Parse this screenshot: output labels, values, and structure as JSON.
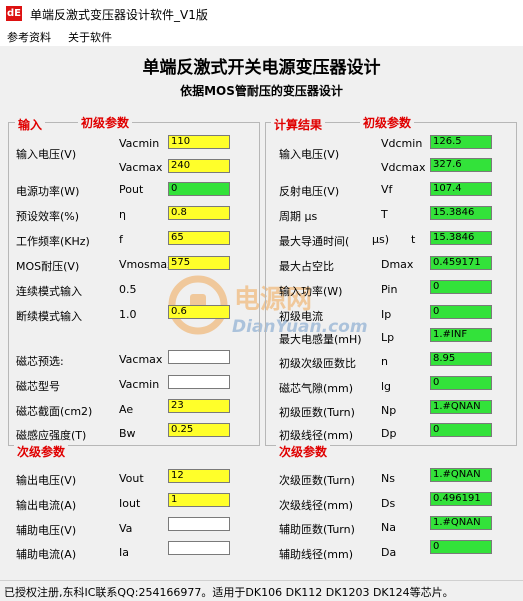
{
  "window": {
    "title": "单端反激式变压器设计软件_V1版",
    "icon_text": "dE"
  },
  "menu": {
    "item1": "参考资料",
    "item2": "关于软件"
  },
  "header": {
    "title": "单端反激式开关电源变压器设计",
    "subtitle": "依据MOS管耐压的变压器设计"
  },
  "input": {
    "section_title": "输入",
    "section_sub": "初级参数",
    "rows": [
      {
        "label": "输入电压(V)",
        "sym": "Vacmin",
        "value": "110"
      },
      {
        "label": "",
        "sym": "Vacmax",
        "value": "240"
      },
      {
        "label": "电源功率(W)",
        "sym": "Pout",
        "value": "0"
      },
      {
        "label": "预设效率(%)",
        "sym": "η",
        "value": "0.8"
      },
      {
        "label": "工作频率(KHz)",
        "sym": "f",
        "value": "65"
      },
      {
        "label": "MOS耐压(V)",
        "sym": "Vmosmax",
        "value": "575"
      },
      {
        "label": "连续模式输入",
        "sym": "0.5",
        "value": ""
      },
      {
        "label": "断续模式输入",
        "sym": "1.0",
        "value": "0.6"
      },
      {
        "label": "磁芯预选:",
        "sym": "Vacmax",
        "value": ""
      },
      {
        "label": "磁芯型号",
        "sym": "Vacmin",
        "value": ""
      },
      {
        "label": "磁芯截面(cm2)",
        "sym": "Ae",
        "value": "23"
      },
      {
        "label": "磁感应强度(T)",
        "sym": "Bw",
        "value": "0.25"
      }
    ]
  },
  "secondary": {
    "section_title": "次级参数",
    "rows": [
      {
        "label": "输出电压(V)",
        "sym": "Vout",
        "value": "12"
      },
      {
        "label": "输出电流(A)",
        "sym": "Iout",
        "value": "1"
      },
      {
        "label": "辅助电压(V)",
        "sym": "Va",
        "value": ""
      },
      {
        "label": "辅助电流(A)",
        "sym": "Ia",
        "value": ""
      }
    ]
  },
  "result": {
    "section_title": "计算结果",
    "section_sub": "初级参数",
    "rows": [
      {
        "label": "输入电压(V)",
        "sym": "Vdcmin",
        "value": "126.5"
      },
      {
        "label": "",
        "sym": "Vdcmax",
        "value": "327.6"
      },
      {
        "label": "反射电压(V)",
        "sym": "Vf",
        "value": "107.4"
      },
      {
        "label": "周期 μs",
        "sym": "T",
        "value": "15.3846"
      },
      {
        "label": "最大导通时间(",
        "label2": "μs)",
        "sym": "t",
        "value": "15.3846"
      },
      {
        "label": "最大占空比",
        "sym": "Dmax",
        "value": "0.459171"
      },
      {
        "label": "输入功率(W)",
        "sym": "Pin",
        "value": "0"
      },
      {
        "label": "初级电流",
        "sym": "Ip",
        "value": "0"
      },
      {
        "label": "最大电感量(mH)",
        "sym": "Lp",
        "value": "1.#INF"
      },
      {
        "label": "初级次级匝数比",
        "sym": "n",
        "value": "8.95"
      },
      {
        "label": "磁芯气隙(mm)",
        "sym": "lg",
        "value": "0"
      },
      {
        "label": "初级匝数(Turn)",
        "sym": "Np",
        "value": "1.#QNAN"
      },
      {
        "label": "初级线径(mm)",
        "sym": "Dp",
        "value": "0"
      }
    ]
  },
  "result_secondary": {
    "section_title": "次级参数",
    "rows": [
      {
        "label": "次级匝数(Turn)",
        "sym": "Ns",
        "value": "1.#QNAN"
      },
      {
        "label": "次级线径(mm)",
        "sym": "Ds",
        "value": "0.496191"
      },
      {
        "label": "辅助匝数(Turn)",
        "sym": "Na",
        "value": "1.#QNAN"
      },
      {
        "label": "辅助线径(mm)",
        "sym": "Da",
        "value": "0"
      }
    ]
  },
  "watermark": {
    "cn": "电源网",
    "en": "DianYuan.com"
  },
  "status": {
    "text": "已授权注册,东科IC联系QQ:254166977。适用于DK106 DK112 DK1203 DK124等芯片。"
  },
  "colors": {
    "input_field": "#ffff2a",
    "result_field": "#33e23a",
    "section_title": "#e00000"
  }
}
